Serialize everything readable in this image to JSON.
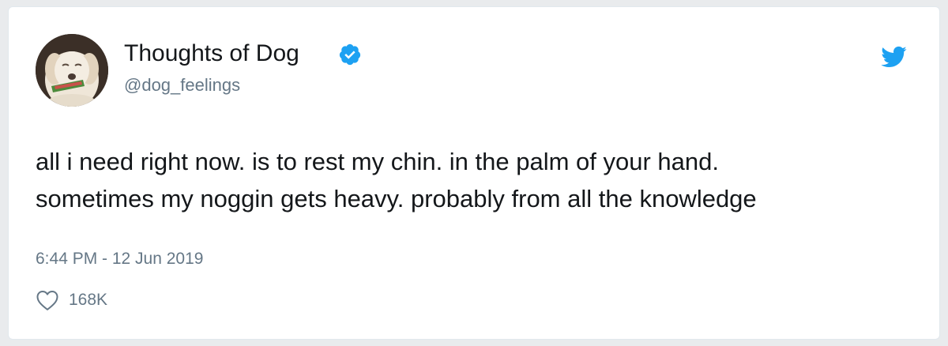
{
  "tweet": {
    "author": {
      "display_name": "Thoughts of Dog",
      "handle": "@dog_feelings",
      "verified": true
    },
    "text_lines": [
      "all i need right now. is to rest my chin. in the palm of your hand.",
      "sometimes my noggin gets heavy. probably from all the knowledge"
    ],
    "timestamp": "6:44 PM - 12 Jun 2019",
    "likes": "168K"
  },
  "colors": {
    "twitter_blue": "#1da1f2",
    "text_primary": "#14171a",
    "text_secondary": "#657786"
  },
  "icons": {
    "brand": "twitter-bird-icon",
    "verified": "verified-badge-icon",
    "like": "heart-icon"
  }
}
